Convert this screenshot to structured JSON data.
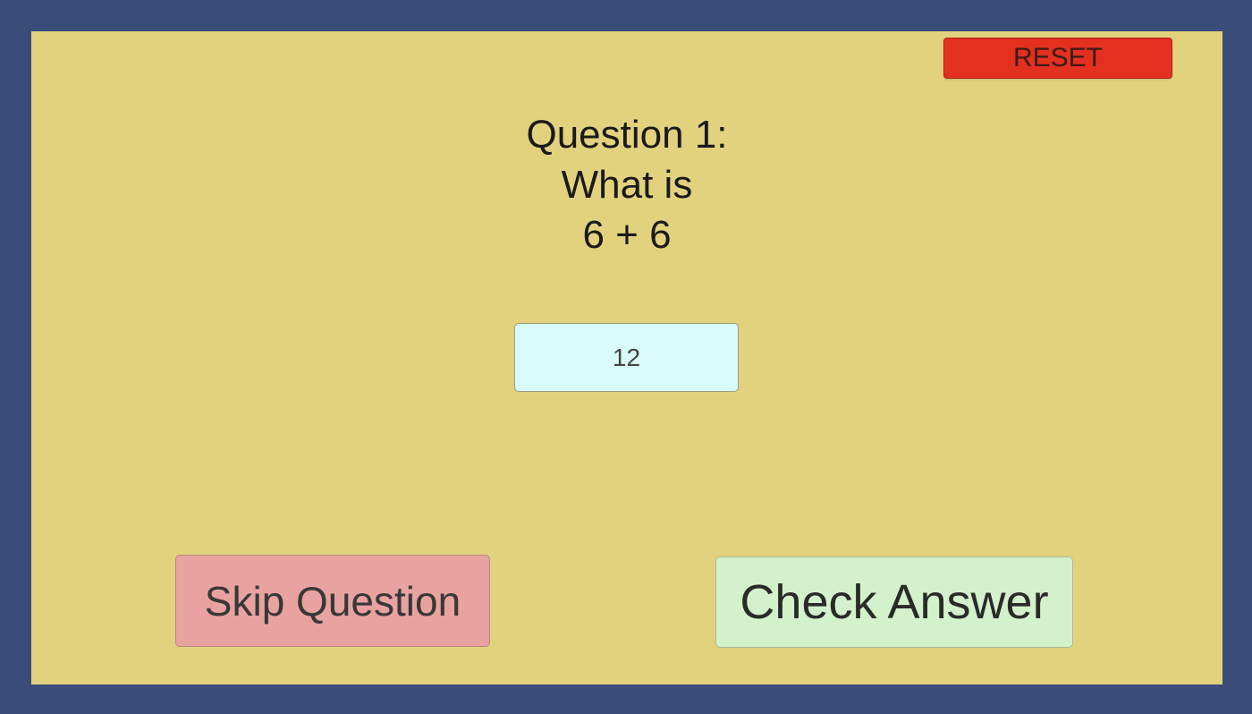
{
  "colors": {
    "frame": "#3a4d78",
    "panel": "#e2d27e",
    "reset": "#e3301f",
    "input": "#d9fbfb",
    "skip": "#e8a2a0",
    "check": "#d3f2cb"
  },
  "toolbar": {
    "reset_label": "RESET"
  },
  "question": {
    "line1": "Question 1:",
    "line2": "What is",
    "line3": "6 + 6"
  },
  "answer": {
    "value": "12"
  },
  "actions": {
    "skip_label": "Skip Question",
    "check_label": "Check Answer"
  }
}
